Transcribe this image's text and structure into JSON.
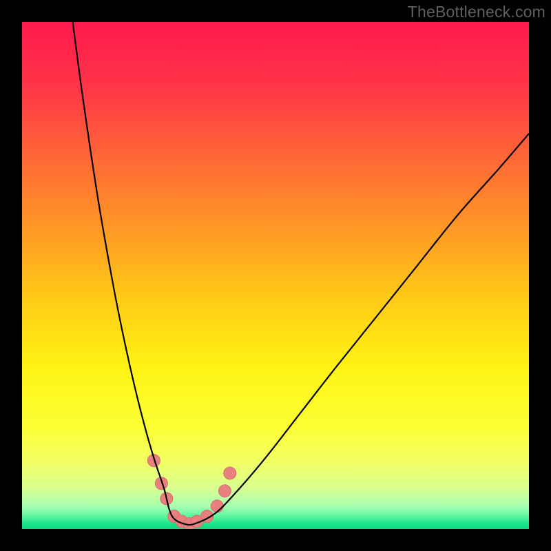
{
  "watermark": "TheBottleneck.com",
  "gradient": {
    "stops": [
      {
        "pos": 0.0,
        "color": "#ff1a4d"
      },
      {
        "pos": 0.12,
        "color": "#ff3248"
      },
      {
        "pos": 0.25,
        "color": "#ff6138"
      },
      {
        "pos": 0.4,
        "color": "#ff9526"
      },
      {
        "pos": 0.55,
        "color": "#ffcc15"
      },
      {
        "pos": 0.68,
        "color": "#fff314"
      },
      {
        "pos": 0.8,
        "color": "#fcff33"
      },
      {
        "pos": 0.87,
        "color": "#f2ff66"
      },
      {
        "pos": 0.92,
        "color": "#d7ff90"
      },
      {
        "pos": 0.955,
        "color": "#a8ffb0"
      },
      {
        "pos": 0.975,
        "color": "#5cf7a0"
      },
      {
        "pos": 0.99,
        "color": "#18e487"
      },
      {
        "pos": 1.0,
        "color": "#10d880"
      }
    ]
  },
  "chart_data": {
    "type": "line",
    "title": "",
    "xlabel": "",
    "ylabel": "",
    "xlim": [
      0,
      100
    ],
    "ylim": [
      0,
      100
    ],
    "grid": false,
    "series": [
      {
        "name": "bottleneck-curve",
        "x": [
          10,
          12,
          15,
          18,
          20,
          22,
          24,
          26,
          28,
          29,
          30,
          32,
          34,
          38,
          42,
          48,
          55,
          62,
          70,
          78,
          86,
          94,
          100
        ],
        "y": [
          100,
          85,
          65,
          48,
          38,
          29,
          21,
          14,
          8,
          4,
          2,
          1,
          1,
          3,
          7,
          14,
          23,
          32,
          42,
          52,
          62,
          71,
          78
        ]
      }
    ],
    "markers": [
      {
        "x": 26.0,
        "y": 13.5
      },
      {
        "x": 27.5,
        "y": 9.0
      },
      {
        "x": 28.5,
        "y": 6.0
      },
      {
        "x": 30.0,
        "y": 2.5
      },
      {
        "x": 31.5,
        "y": 1.5
      },
      {
        "x": 33.0,
        "y": 1.0
      },
      {
        "x": 34.5,
        "y": 1.5
      },
      {
        "x": 36.5,
        "y": 2.5
      },
      {
        "x": 38.5,
        "y": 4.5
      },
      {
        "x": 40.0,
        "y": 7.5
      },
      {
        "x": 41.0,
        "y": 11.0
      }
    ],
    "marker_style": {
      "fill": "#e98080",
      "stroke": "#d86c6c",
      "r": 9
    },
    "curve_style": {
      "stroke": "#000000",
      "width": 2.2
    }
  }
}
